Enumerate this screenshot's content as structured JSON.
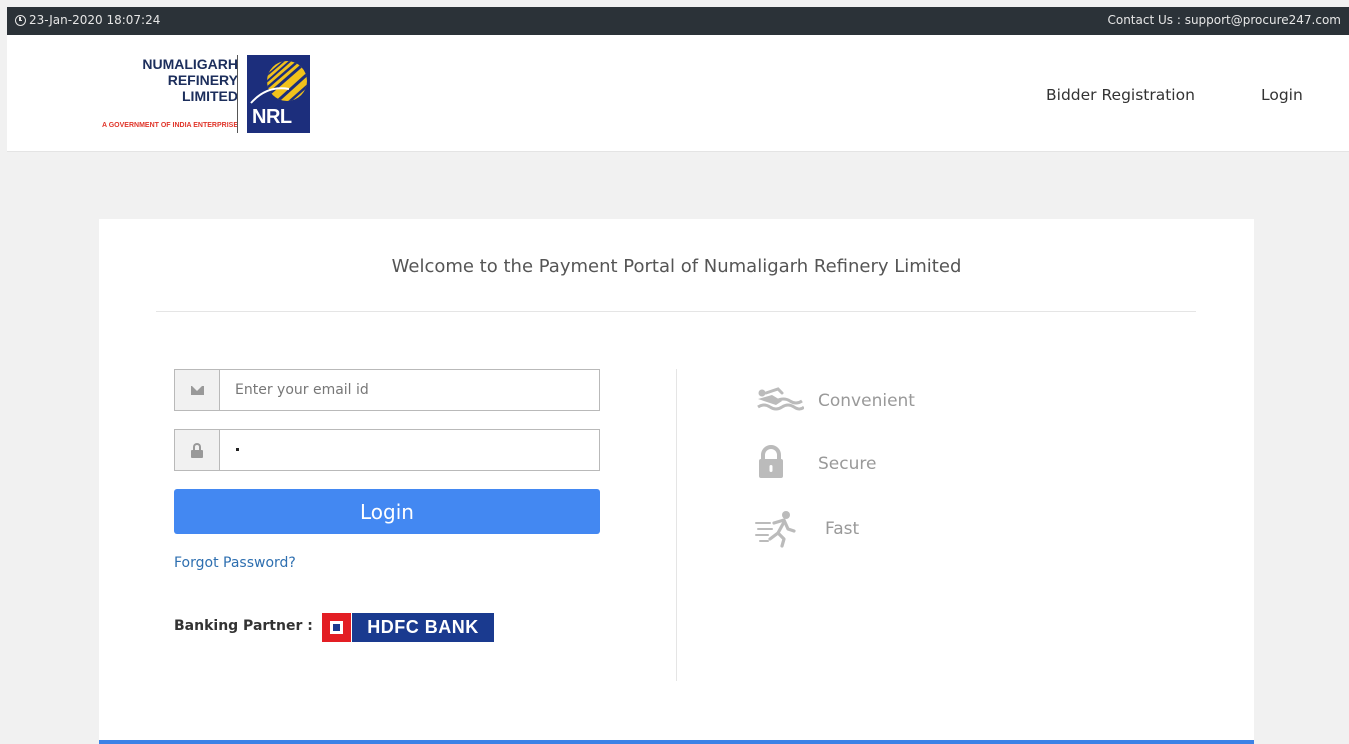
{
  "topbar": {
    "datetime": "23-Jan-2020 18:07:24",
    "contact": "Contact Us : support@procure247.com"
  },
  "header": {
    "logo": {
      "line1": "NUMALIGARH",
      "line2": "REFINERY",
      "line3": "LIMITED",
      "tagline": "A GOVERNMENT OF INDIA ENTERPRISE",
      "mark_text": "NRL"
    },
    "nav": {
      "registration": "Bidder Registration",
      "login": "Login"
    }
  },
  "portal": {
    "welcome": "Welcome to the Payment Portal of Numaligarh Refinery Limited",
    "email_placeholder": "Enter your email id",
    "login_button": "Login",
    "forgot_password": "Forgot Password?",
    "banking_partner": "Banking Partner :",
    "bank_name": "HDFC BANK",
    "features": [
      {
        "label": "Convenient",
        "icon": "swimmer-icon"
      },
      {
        "label": "Secure",
        "icon": "lock-icon"
      },
      {
        "label": "Fast",
        "icon": "runner-icon"
      }
    ]
  },
  "colors": {
    "topbar": "#2b3238",
    "primary": "#4388f2",
    "link": "#2e6fb0",
    "feature": "#999999",
    "hdfc_blue": "#1a3a8f",
    "hdfc_red": "#e31e24"
  }
}
